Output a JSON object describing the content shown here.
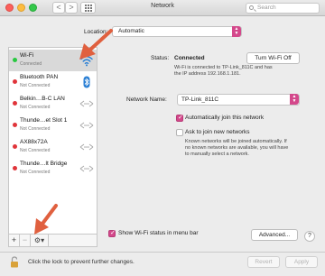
{
  "window": {
    "title": "Network",
    "search_placeholder": "Search",
    "back_glyph": "<",
    "forward_glyph": ">"
  },
  "location": {
    "label": "Location:",
    "value": "Automatic"
  },
  "services": [
    {
      "name": "Wi-Fi",
      "status": "Connected",
      "dot_color": "#28c840",
      "icon": "wifi-icon",
      "selected": true
    },
    {
      "name": "Bluetooth PAN",
      "status": "Not Connected",
      "dot_color": "#e0343a",
      "icon": "bluetooth-icon",
      "selected": false
    },
    {
      "name": "Belkin…B-C LAN",
      "status": "Not Connected",
      "dot_color": "#e0343a",
      "icon": "ethernet-icon",
      "selected": false
    },
    {
      "name": "Thunde…et Slot 1",
      "status": "Not Connected",
      "dot_color": "#e0343a",
      "icon": "ethernet-icon",
      "selected": false
    },
    {
      "name": "AX88x72A",
      "status": "Not Connected",
      "dot_color": "#e0343a",
      "icon": "ethernet-icon",
      "selected": false
    },
    {
      "name": "Thunde…lt Bridge",
      "status": "Not Connected",
      "dot_color": "#e0343a",
      "icon": "ethernet-icon",
      "selected": false
    }
  ],
  "sidebar_controls": {
    "add": "+",
    "remove": "−",
    "gear": "⚙▾"
  },
  "detail": {
    "status_label": "Status:",
    "status_value": "Connected",
    "turn_off_button": "Turn Wi-Fi Off",
    "status_desc_line1": "Wi-Fi is connected to TP-Link_811C and has",
    "status_desc_line2": "the IP address 192.168.1.181.",
    "network_name_label": "Network Name:",
    "network_name_value": "TP-Link_811C",
    "auto_join_label": "Automatically join this network",
    "auto_join_checked": true,
    "ask_join_label": "Ask to join new networks",
    "ask_join_checked": false,
    "ask_desc_line1": "Known networks will be joined automatically. If",
    "ask_desc_line2": "no known networks are available, you will have",
    "ask_desc_line3": "to manually select a network.",
    "show_status_label": "Show Wi-Fi status in menu bar",
    "show_status_checked": true,
    "advanced_button": "Advanced...",
    "help_button": "?"
  },
  "footer": {
    "lock_text": "Click the lock to prevent further changes.",
    "revert_button": "Revert",
    "apply_button": "Apply"
  },
  "colors": {
    "accent": "#d4488b",
    "annotation_arrow": "#e0603f",
    "connected": "#28c840",
    "not_connected": "#e0343a",
    "wifi_blue": "#2a7fd4"
  }
}
